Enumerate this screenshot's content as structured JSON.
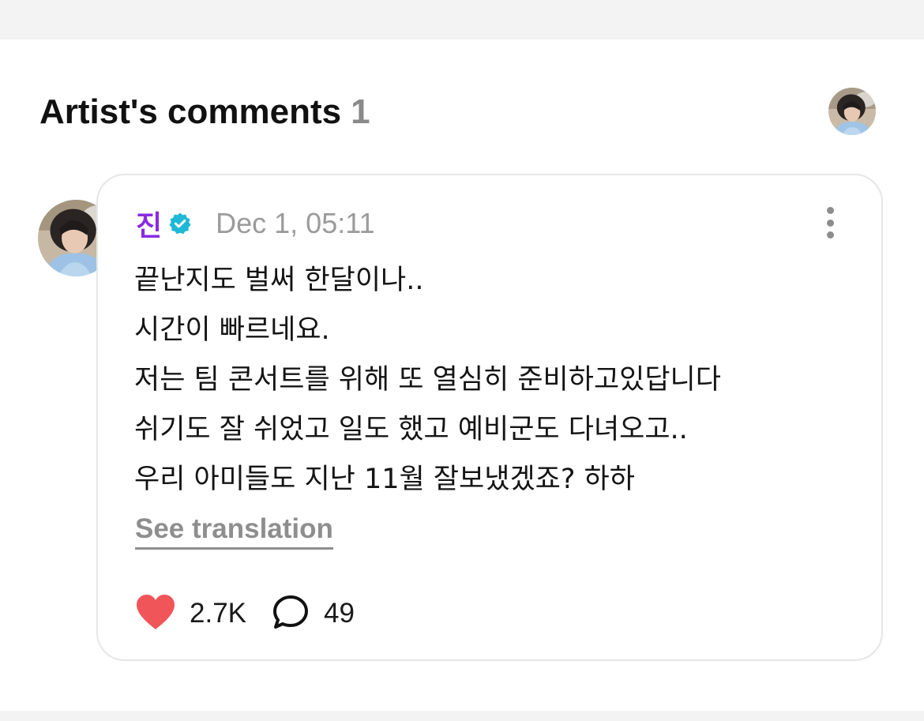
{
  "section": {
    "title": "Artist's comments",
    "count": "1"
  },
  "comment": {
    "author": "진",
    "timestamp": "Dec 1, 05:11",
    "lines": [
      "끝난지도 벌써 한달이나..",
      "시간이 빠르네요.",
      "저는 팀 콘서트를 위해 또 열심히 준비하고있답니다",
      "쉬기도 잘 쉬었고 일도 했고 예비군도 다녀오고..",
      "우리 아미들도 지난 11월 잘보냈겠죠? 하하"
    ],
    "translate_label": "See translation",
    "likes": "2.7K",
    "replies": "49"
  },
  "icons": {
    "verified": "verified-badge-icon",
    "more": "more-vertical-icon",
    "like": "heart-icon",
    "reply": "speech-bubble-icon"
  },
  "colors": {
    "author_name": "#8a2be2",
    "verified_badge": "#1fb8d6",
    "heart": "#f0555a",
    "muted_text": "#9b9b9b"
  }
}
